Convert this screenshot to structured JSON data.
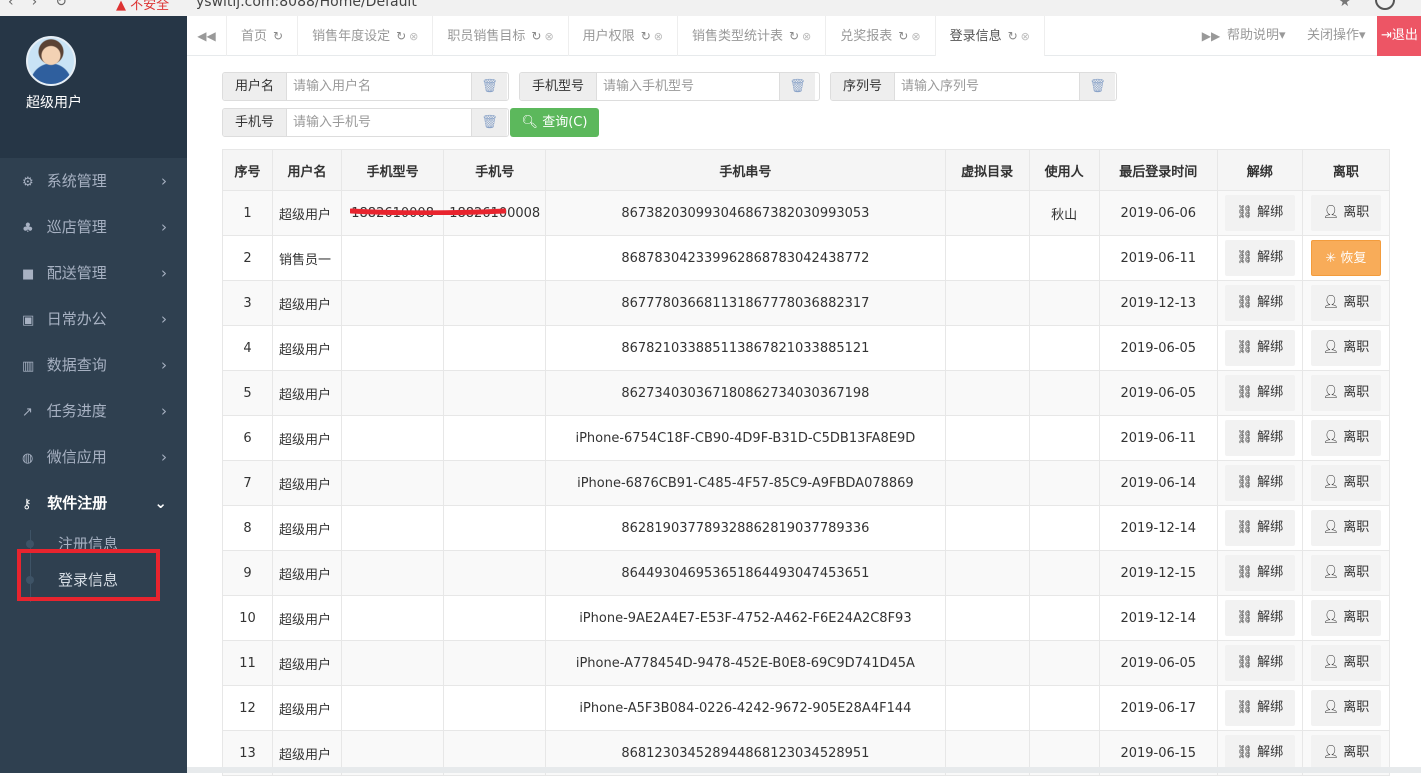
{
  "browser": {
    "warning": "不安全",
    "url": "yswitij.com:8088/Home/Default"
  },
  "user": {
    "name": "超级用户"
  },
  "sidebar": {
    "items": [
      {
        "icon": "gears-icon",
        "glyph": "⚙",
        "label": "系统管理"
      },
      {
        "icon": "sitemap-icon",
        "glyph": "♣",
        "label": "巡店管理"
      },
      {
        "icon": "truck-icon",
        "glyph": "■",
        "label": "配送管理"
      },
      {
        "icon": "briefcase-icon",
        "glyph": "▣",
        "label": "日常办公"
      },
      {
        "icon": "bar-chart-icon",
        "glyph": "▥",
        "label": "数据查询"
      },
      {
        "icon": "line-chart-icon",
        "glyph": "↗",
        "label": "任务进度"
      },
      {
        "icon": "wechat-icon",
        "glyph": "◍",
        "label": "微信应用"
      },
      {
        "icon": "key-icon",
        "glyph": "⚷",
        "label": "软件注册"
      }
    ],
    "submenu": [
      {
        "label": "注册信息"
      },
      {
        "label": "登录信息"
      }
    ]
  },
  "tabs": [
    {
      "label": "首页"
    },
    {
      "label": "销售年度设定"
    },
    {
      "label": "职员销售目标"
    },
    {
      "label": "用户权限"
    },
    {
      "label": "销售类型统计表"
    },
    {
      "label": "兑奖报表"
    },
    {
      "label": "登录信息"
    }
  ],
  "topbar": {
    "help": "帮助说明",
    "close_ops": "关闭操作",
    "logout": "退出"
  },
  "search": {
    "username": {
      "label": "用户名",
      "placeholder": "请输入用户名"
    },
    "model": {
      "label": "手机型号",
      "placeholder": "请输入手机型号"
    },
    "serial": {
      "label": "序列号",
      "placeholder": "请输入序列号"
    },
    "phone": {
      "label": "手机号",
      "placeholder": "请输入手机号"
    },
    "query_label": "查询(C)"
  },
  "table": {
    "headers": [
      "序号",
      "用户名",
      "手机型号",
      "手机号",
      "手机串号",
      "虚拟目录",
      "使用人",
      "最后登录时间",
      "解绑",
      "离职"
    ],
    "unbind_label": "解绑",
    "resign_label": "离职",
    "restore_label": "恢复",
    "rows": [
      {
        "no": "1",
        "user": "超级用户",
        "model": "1882610008",
        "phone": "18826100008",
        "imei": "867382030993046867382030993053",
        "vdir": "",
        "person": "秋山",
        "last": "2019-06-06",
        "restore": false
      },
      {
        "no": "2",
        "user": "销售员一",
        "model": "",
        "phone": "",
        "imei": "868783042339962868783042438772",
        "vdir": "",
        "person": "",
        "last": "2019-06-11",
        "restore": true
      },
      {
        "no": "3",
        "user": "超级用户",
        "model": "",
        "phone": "",
        "imei": "867778036681131867778036882317",
        "vdir": "",
        "person": "",
        "last": "2019-12-13",
        "restore": false
      },
      {
        "no": "4",
        "user": "超级用户",
        "model": "",
        "phone": "",
        "imei": "867821033885113867821033885121",
        "vdir": "",
        "person": "",
        "last": "2019-06-05",
        "restore": false
      },
      {
        "no": "5",
        "user": "超级用户",
        "model": "",
        "phone": "",
        "imei": "862734030367180862734030367198",
        "vdir": "",
        "person": "",
        "last": "2019-06-05",
        "restore": false
      },
      {
        "no": "6",
        "user": "超级用户",
        "model": "",
        "phone": "",
        "imei": "iPhone-6754C18F-CB90-4D9F-B31D-C5DB13FA8E9D",
        "vdir": "",
        "person": "",
        "last": "2019-06-11",
        "restore": false
      },
      {
        "no": "7",
        "user": "超级用户",
        "model": "",
        "phone": "",
        "imei": "iPhone-6876CB91-C485-4F57-85C9-A9FBDA078869",
        "vdir": "",
        "person": "",
        "last": "2019-06-14",
        "restore": false
      },
      {
        "no": "8",
        "user": "超级用户",
        "model": "",
        "phone": "",
        "imei": "862819037789328862819037789336",
        "vdir": "",
        "person": "",
        "last": "2019-12-14",
        "restore": false
      },
      {
        "no": "9",
        "user": "超级用户",
        "model": "",
        "phone": "",
        "imei": "864493046953651864493047453651",
        "vdir": "",
        "person": "",
        "last": "2019-12-15",
        "restore": false
      },
      {
        "no": "10",
        "user": "超级用户",
        "model": "",
        "phone": "",
        "imei": "iPhone-9AE2A4E7-E53F-4752-A462-F6E24A2C8F93",
        "vdir": "",
        "person": "",
        "last": "2019-12-14",
        "restore": false
      },
      {
        "no": "11",
        "user": "超级用户",
        "model": "",
        "phone": "",
        "imei": "iPhone-A778454D-9478-452E-B0E8-69C9D741D45A",
        "vdir": "",
        "person": "",
        "last": "2019-06-05",
        "restore": false
      },
      {
        "no": "12",
        "user": "超级用户",
        "model": "",
        "phone": "",
        "imei": "iPhone-A5F3B084-0226-4242-9672-905E28A4F144",
        "vdir": "",
        "person": "",
        "last": "2019-06-17",
        "restore": false
      },
      {
        "no": "13",
        "user": "超级用户",
        "model": "",
        "phone": "",
        "imei": "868123034528944868123034528951",
        "vdir": "",
        "person": "",
        "last": "2019-06-15",
        "restore": false
      }
    ]
  }
}
